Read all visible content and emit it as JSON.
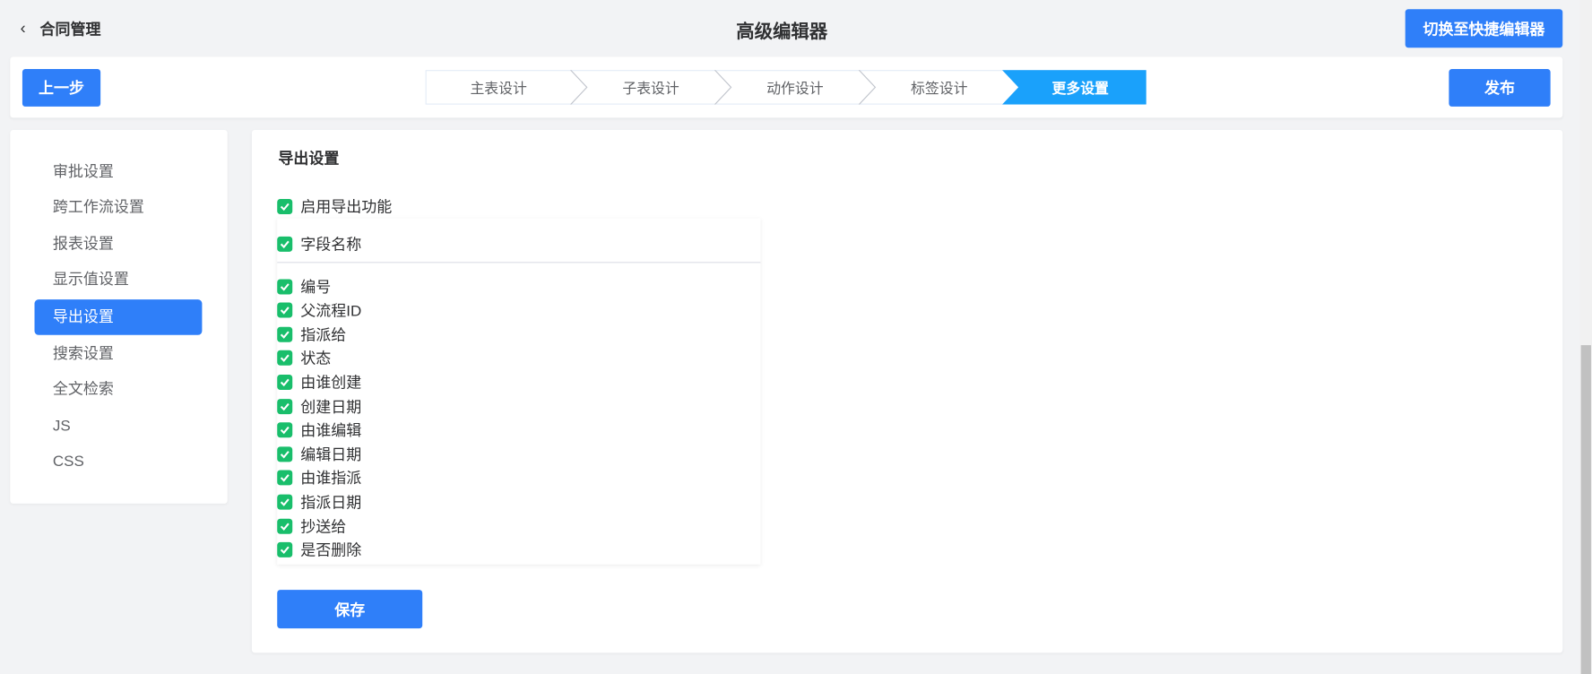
{
  "header": {
    "back_label": "合同管理",
    "title": "高级编辑器",
    "switch_label": "切换至快捷编辑器"
  },
  "toolbar": {
    "prev_label": "上一步",
    "publish_label": "发布",
    "steps": [
      "主表设计",
      "子表设计",
      "动作设计",
      "标签设计",
      "更多设置"
    ]
  },
  "sidebar": {
    "items": [
      "审批设置",
      "跨工作流设置",
      "报表设置",
      "显示值设置",
      "导出设置",
      "搜索设置",
      "全文检索",
      "JS",
      "CSS"
    ]
  },
  "main": {
    "section_title": "导出设置",
    "enable_label": "启用导出功能",
    "header_field": "字段名称",
    "fields": [
      "编号",
      "父流程ID",
      "指派给",
      "状态",
      "由谁创建",
      "创建日期",
      "由谁编辑",
      "编辑日期",
      "由谁指派",
      "指派日期",
      "抄送给",
      "是否删除"
    ],
    "save_label": "保存"
  },
  "colors": {
    "accent": "#2f7ff9",
    "step_active": "#1aa1fb",
    "check": "#19be6b"
  }
}
